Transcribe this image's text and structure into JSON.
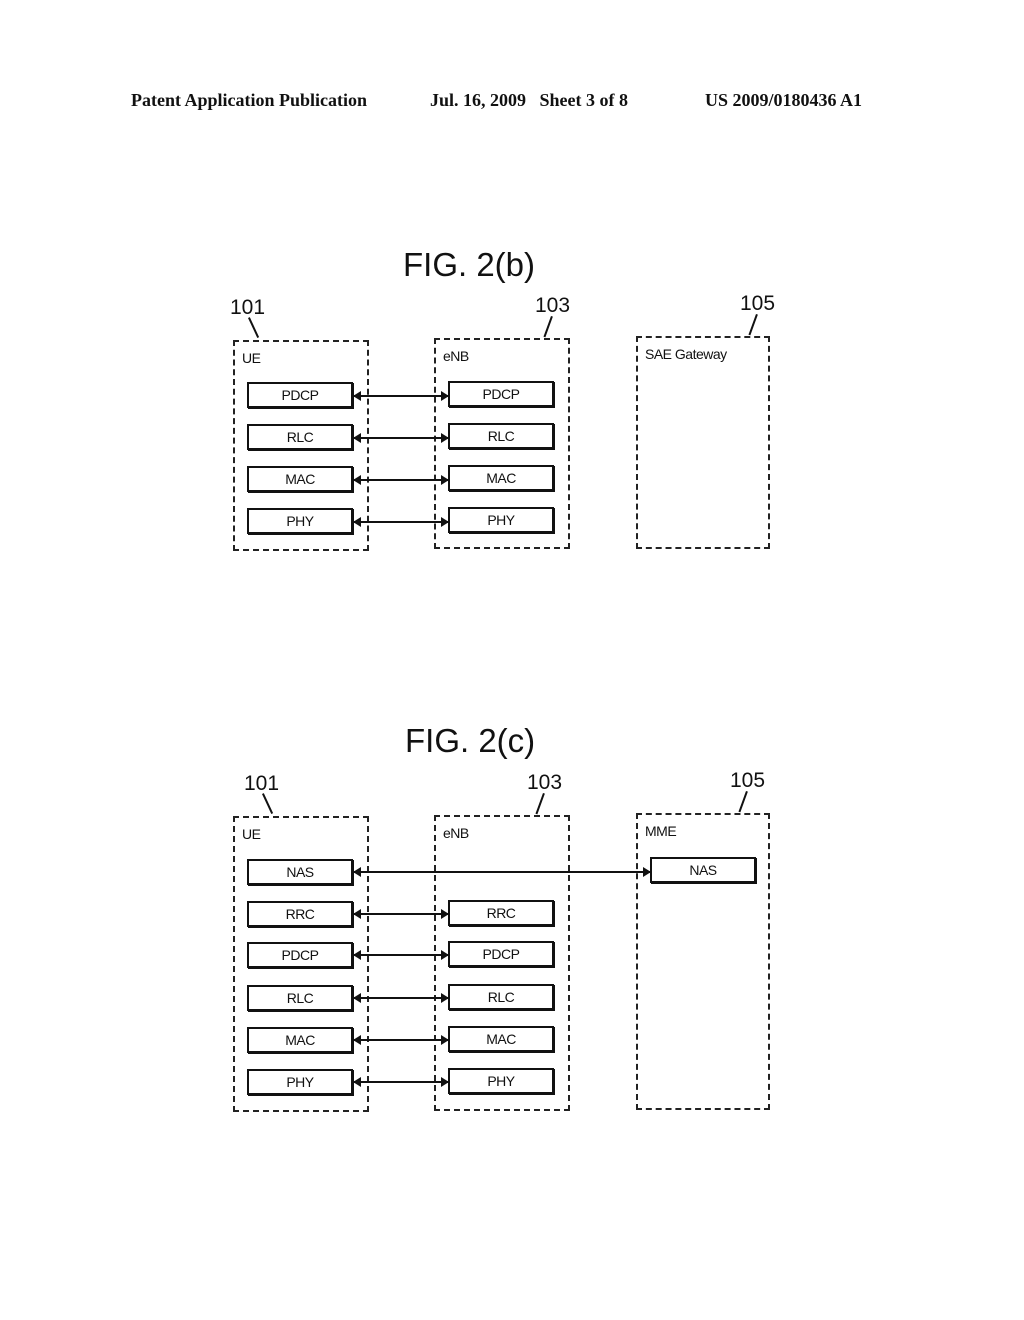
{
  "header": {
    "publication": "Patent Application Publication",
    "date_sheet": "Jul. 16, 2009   Sheet 3 of 8",
    "number": "US 2009/0180436 A1"
  },
  "fig_b": {
    "title": "FIG. 2(b)",
    "nodes": [
      {
        "ref": "101",
        "label": "UE",
        "layers": [
          "PDCP",
          "RLC",
          "MAC",
          "PHY"
        ]
      },
      {
        "ref": "103",
        "label": "eNB",
        "layers": [
          "PDCP",
          "RLC",
          "MAC",
          "PHY"
        ]
      },
      {
        "ref": "105",
        "label": "SAE Gateway",
        "layers": []
      }
    ],
    "links": [
      {
        "from": "UE.PDCP",
        "to": "eNB.PDCP"
      },
      {
        "from": "UE.RLC",
        "to": "eNB.RLC"
      },
      {
        "from": "UE.MAC",
        "to": "eNB.MAC"
      },
      {
        "from": "UE.PHY",
        "to": "eNB.PHY"
      }
    ]
  },
  "fig_c": {
    "title": "FIG. 2(c)",
    "nodes": [
      {
        "ref": "101",
        "label": "UE",
        "layers": [
          "NAS",
          "RRC",
          "PDCP",
          "RLC",
          "MAC",
          "PHY"
        ]
      },
      {
        "ref": "103",
        "label": "eNB",
        "layers": [
          "RRC",
          "PDCP",
          "RLC",
          "MAC",
          "PHY"
        ]
      },
      {
        "ref": "105",
        "label": "MME",
        "layers": [
          "NAS"
        ]
      }
    ],
    "links": [
      {
        "from": "UE.NAS",
        "to": "MME.NAS"
      },
      {
        "from": "UE.RRC",
        "to": "eNB.RRC"
      },
      {
        "from": "UE.PDCP",
        "to": "eNB.PDCP"
      },
      {
        "from": "UE.RLC",
        "to": "eNB.RLC"
      },
      {
        "from": "UE.MAC",
        "to": "eNB.MAC"
      },
      {
        "from": "UE.PHY",
        "to": "eNB.PHY"
      }
    ]
  }
}
